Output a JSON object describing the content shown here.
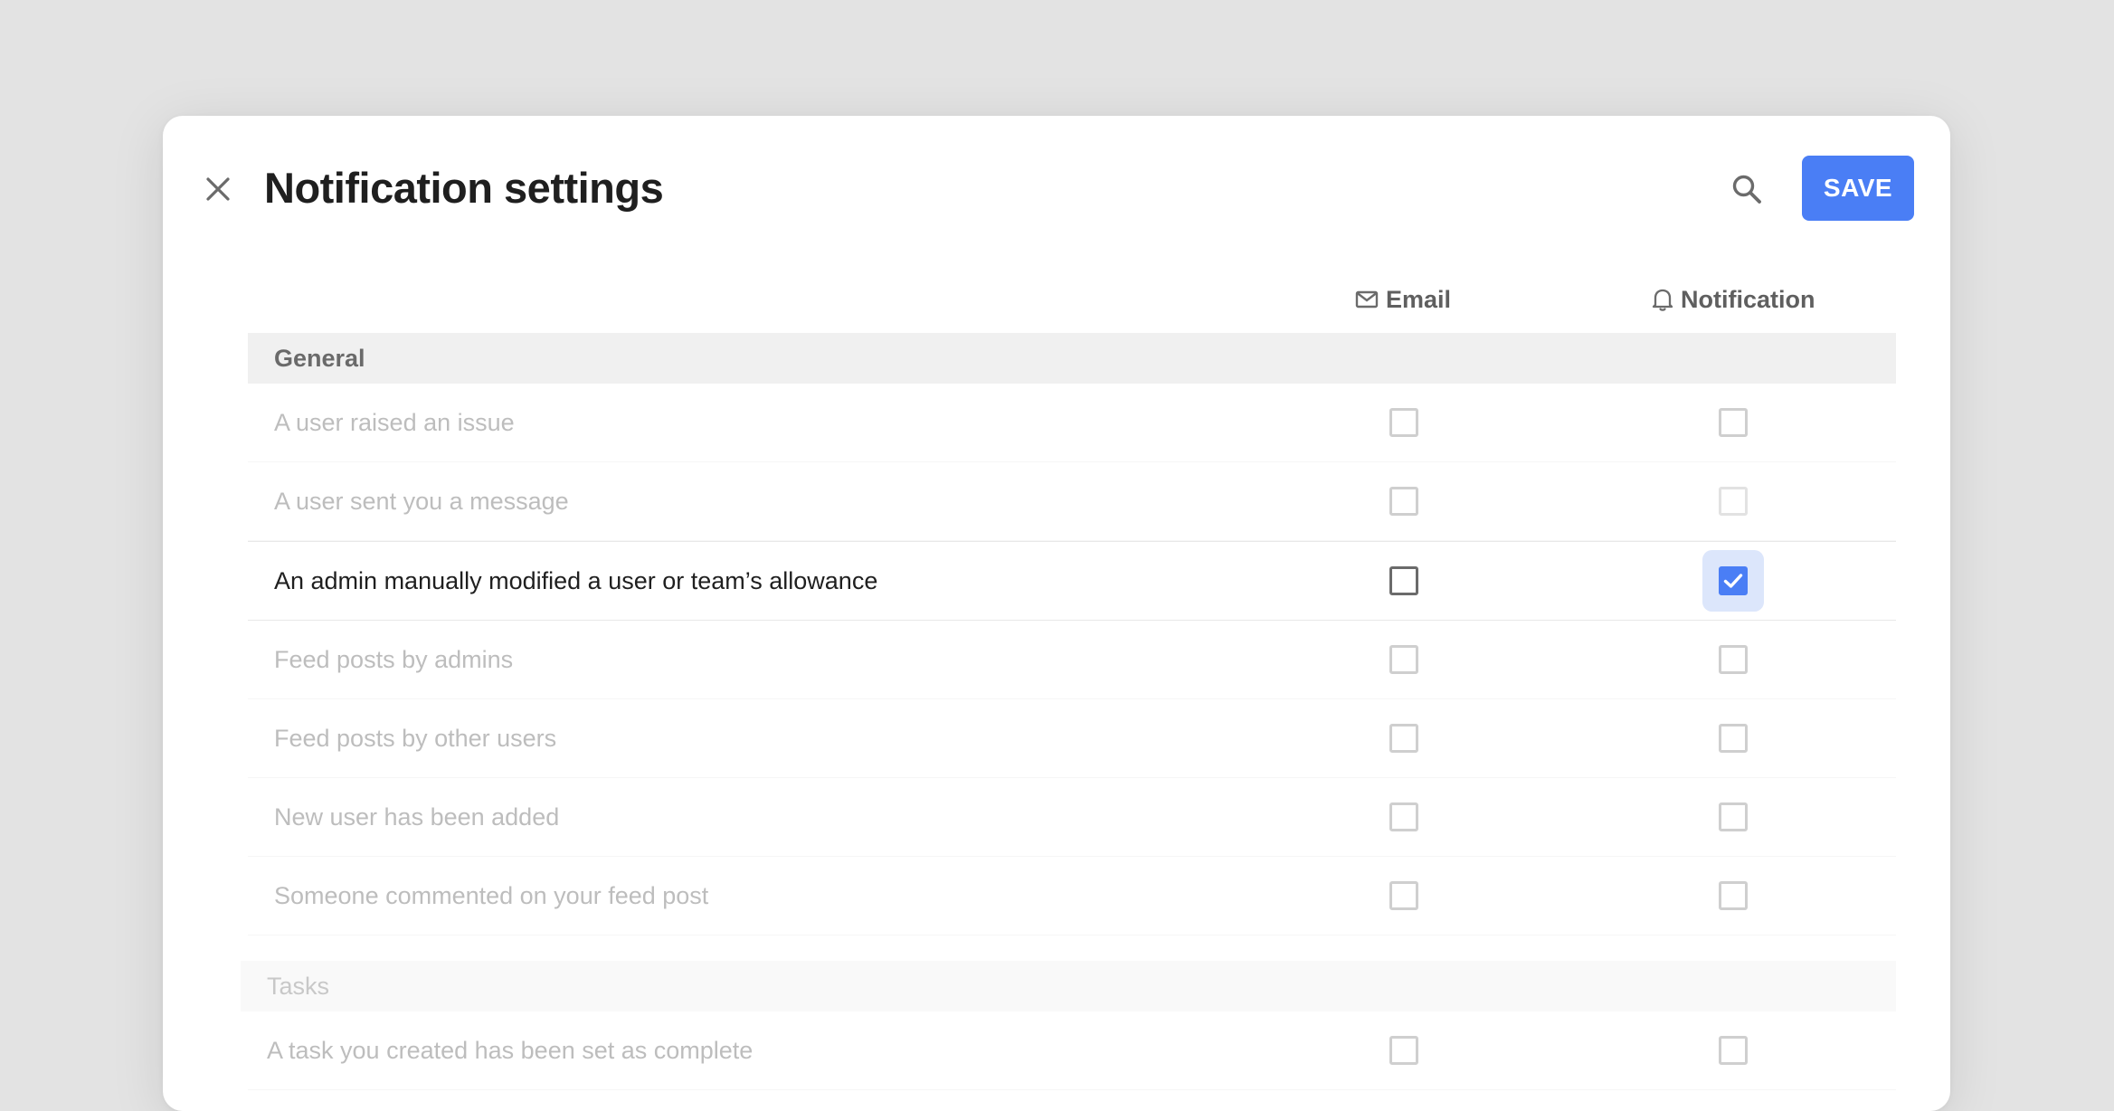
{
  "dialog": {
    "title": "Notification settings",
    "save_label": "SAVE",
    "icons": {
      "close": "close-icon",
      "search": "search-icon",
      "email": "mail-icon",
      "notification": "bell-icon"
    }
  },
  "columns": {
    "email": "Email",
    "notification": "Notification"
  },
  "colors": {
    "accent": "#4a7ef5",
    "check_halo": "#dce6fb",
    "backdrop": "#e3e3e3"
  },
  "sections": [
    {
      "name": "General",
      "rows": [
        {
          "label": "A user raised an issue",
          "email": false,
          "notification": false
        },
        {
          "label": "A user sent you a message",
          "email": false,
          "notification": false
        },
        {
          "label": "An admin manually modified a user or team’s allowance",
          "email": false,
          "notification": true
        },
        {
          "label": "Feed posts by admins",
          "email": false,
          "notification": false
        },
        {
          "label": "Feed posts by other users",
          "email": false,
          "notification": false
        },
        {
          "label": "New user has been added",
          "email": false,
          "notification": false
        },
        {
          "label": "Someone commented on your feed post",
          "email": false,
          "notification": false
        }
      ]
    },
    {
      "name": "Tasks",
      "rows": [
        {
          "label": "A task you created has been set as complete",
          "email": false,
          "notification": false
        }
      ]
    }
  ]
}
